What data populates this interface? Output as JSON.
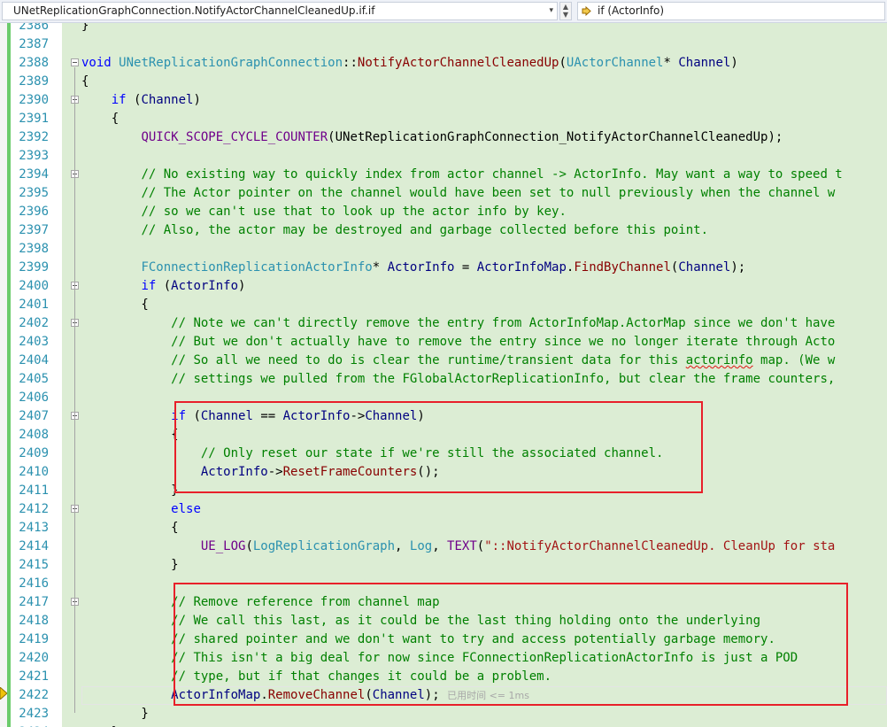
{
  "navbar": {
    "scope": "UNetReplicationGraphConnection.NotifyActorChannelCleanedUp.if.if",
    "member": "if (ActorInfo)",
    "scroll_up_icon": "▲",
    "scroll_down_icon": "▼",
    "drop_arrow": "▾",
    "member_icon": "arrow-right-icon"
  },
  "colors": {
    "keyword": "#0000ff",
    "type": "#2b91af",
    "comment": "#008000",
    "function": "#880000",
    "highlight_box": "#e8202a",
    "changed_bg": "#dcedd4"
  },
  "editor": {
    "perf_tip": "已用时间 <= 1ms",
    "lines": [
      {
        "n": "2386",
        "c": "}"
      },
      {
        "n": "2387",
        "c": ""
      },
      {
        "n": "2388",
        "c": "void UNetReplicationGraphConnection::NotifyActorChannelCleanedUp(UActorChannel* Channel)"
      },
      {
        "n": "2389",
        "c": "{"
      },
      {
        "n": "2390",
        "c": "    if (Channel)"
      },
      {
        "n": "2391",
        "c": "    {"
      },
      {
        "n": "2392",
        "c": "        QUICK_SCOPE_CYCLE_COUNTER(UNetReplicationGraphConnection_NotifyActorChannelCleanedUp);"
      },
      {
        "n": "2393",
        "c": ""
      },
      {
        "n": "2394",
        "c": "        // No existing way to quickly index from actor channel -> ActorInfo. May want a way to speed t"
      },
      {
        "n": "2395",
        "c": "        // The Actor pointer on the channel would have been set to null previously when the channel w"
      },
      {
        "n": "2396",
        "c": "        // so we can't use that to look up the actor info by key."
      },
      {
        "n": "2397",
        "c": "        // Also, the actor may be destroyed and garbage collected before this point."
      },
      {
        "n": "2398",
        "c": ""
      },
      {
        "n": "2399",
        "c": "        FConnectionReplicationActorInfo* ActorInfo = ActorInfoMap.FindByChannel(Channel);"
      },
      {
        "n": "2400",
        "c": "        if (ActorInfo)"
      },
      {
        "n": "2401",
        "c": "        {"
      },
      {
        "n": "2402",
        "c": "            // Note we can't directly remove the entry from ActorInfoMap.ActorMap since we don't have"
      },
      {
        "n": "2403",
        "c": "            // But we don't actually have to remove the entry since we no longer iterate through Acto"
      },
      {
        "n": "2404",
        "c": "            // So all we need to do is clear the runtime/transient data for this actorinfo map. (We w"
      },
      {
        "n": "2405",
        "c": "            // settings we pulled from the FGlobalActorReplicationInfo, but clear the frame counters,"
      },
      {
        "n": "2406",
        "c": ""
      },
      {
        "n": "2407",
        "c": "            if (Channel == ActorInfo->Channel)"
      },
      {
        "n": "2408",
        "c": "            {"
      },
      {
        "n": "2409",
        "c": "                // Only reset our state if we're still the associated channel."
      },
      {
        "n": "2410",
        "c": "                ActorInfo->ResetFrameCounters();"
      },
      {
        "n": "2411",
        "c": "            }"
      },
      {
        "n": "2412",
        "c": "            else"
      },
      {
        "n": "2413",
        "c": "            {"
      },
      {
        "n": "2414",
        "c": "                UE_LOG(LogReplicationGraph, Log, TEXT(\"::NotifyActorChannelCleanedUp. CleanUp for sta"
      },
      {
        "n": "2415",
        "c": "            }"
      },
      {
        "n": "2416",
        "c": ""
      },
      {
        "n": "2417",
        "c": "            // Remove reference from channel map"
      },
      {
        "n": "2418",
        "c": "            // We call this last, as it could be the last thing holding onto the underlying"
      },
      {
        "n": "2419",
        "c": "            // shared pointer and we don't want to try and access potentially garbage memory."
      },
      {
        "n": "2420",
        "c": "            // This isn't a big deal for now since FConnectionReplicationActorInfo is just a POD"
      },
      {
        "n": "2421",
        "c": "            // type, but if that changes it could be a problem."
      },
      {
        "n": "2422",
        "c": "            ActorInfoMap.RemoveChannel(Channel);"
      },
      {
        "n": "2423",
        "c": "        }"
      },
      {
        "n": "2424",
        "c": "    }"
      }
    ]
  }
}
